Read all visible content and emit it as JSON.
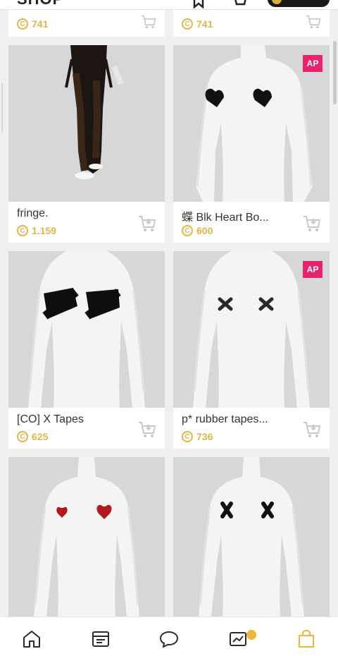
{
  "header": {
    "title": "SHOP"
  },
  "partial_row": [
    {
      "price": "741"
    },
    {
      "price": "741"
    }
  ],
  "products": [
    {
      "name": "fringe.",
      "price": "1.159",
      "badge": "",
      "image": "fringe-pants"
    },
    {
      "name": "蝶 Blk Heart Bo...",
      "price": "600",
      "badge": "AP",
      "image": "heart-pasties"
    },
    {
      "name": "[CO]  X  Tapes",
      "price": "625",
      "badge": "",
      "image": "x-tapes"
    },
    {
      "name": "p* rubber tapes...",
      "price": "736",
      "badge": "AP",
      "image": "rubber-tapes"
    },
    {
      "name": "",
      "price": "",
      "badge": "",
      "image": "red-hearts"
    },
    {
      "name": "",
      "price": "",
      "badge": "",
      "image": "black-x"
    }
  ],
  "bottom_nav": [
    {
      "name": "home-icon"
    },
    {
      "name": "catalog-icon"
    },
    {
      "name": "chat-icon"
    },
    {
      "name": "feed-icon"
    },
    {
      "name": "shop-bag-icon"
    }
  ],
  "colors": {
    "coin": "#e2b545",
    "badge": "#e8246a",
    "active_nav": "#f0b63a",
    "card_bg": "#d7d7d9"
  }
}
